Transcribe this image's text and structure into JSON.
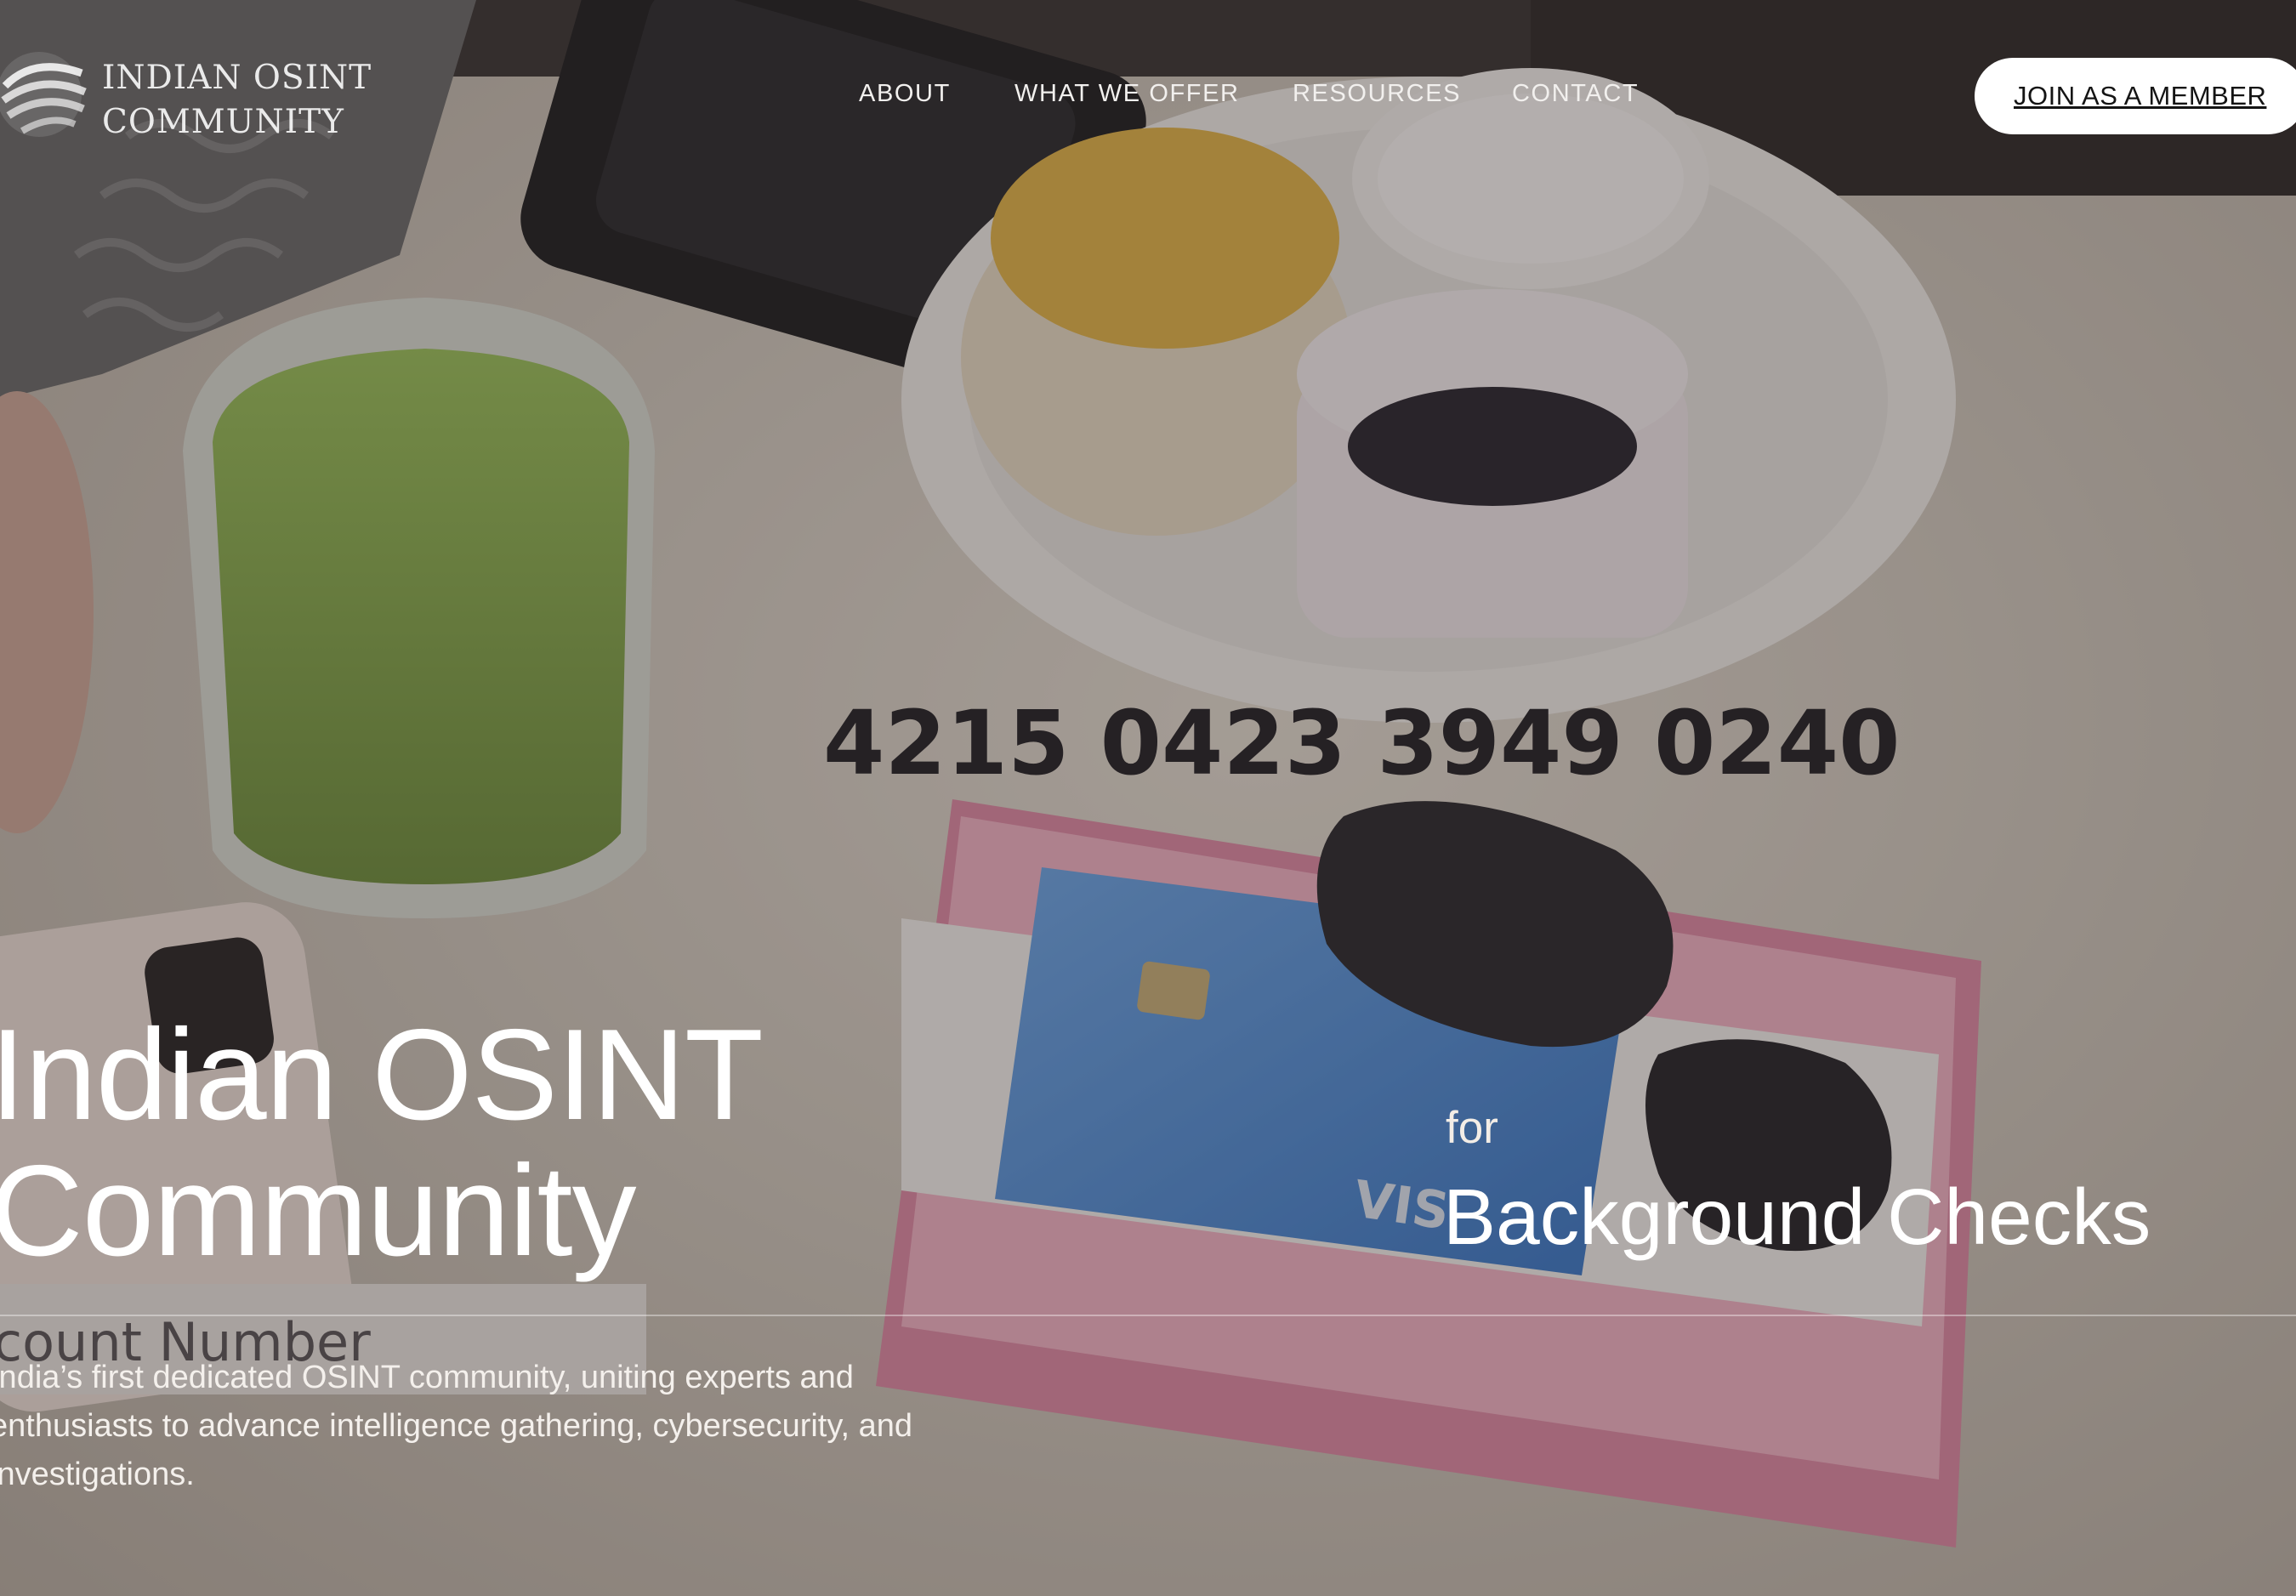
{
  "brand": {
    "name": "INDIAN OSINT\nCOMMUNITY"
  },
  "nav": {
    "items": [
      {
        "label": "ABOUT"
      },
      {
        "label": "WHAT WE OFFER"
      },
      {
        "label": "RESOURCES"
      },
      {
        "label": "CONTACT"
      }
    ],
    "cta_label": "JOIN AS A MEMBER"
  },
  "hero": {
    "title_line1": "Indian OSINT",
    "title_line2": "Community",
    "for_label": "for",
    "rotating_service": "Background Checks",
    "description": "India’s first dedicated OSINT community, uniting experts and enthusiasts to advance intelligence gathering, cybersecurity, and investigations."
  },
  "background": {
    "card_number_overlay": "4215 0423 3949 0240",
    "partial_label": "count Number",
    "card_brand": "VIS"
  },
  "colors": {
    "cta_background": "#ffffff",
    "cta_text": "#141414",
    "text": "#ffffff"
  }
}
